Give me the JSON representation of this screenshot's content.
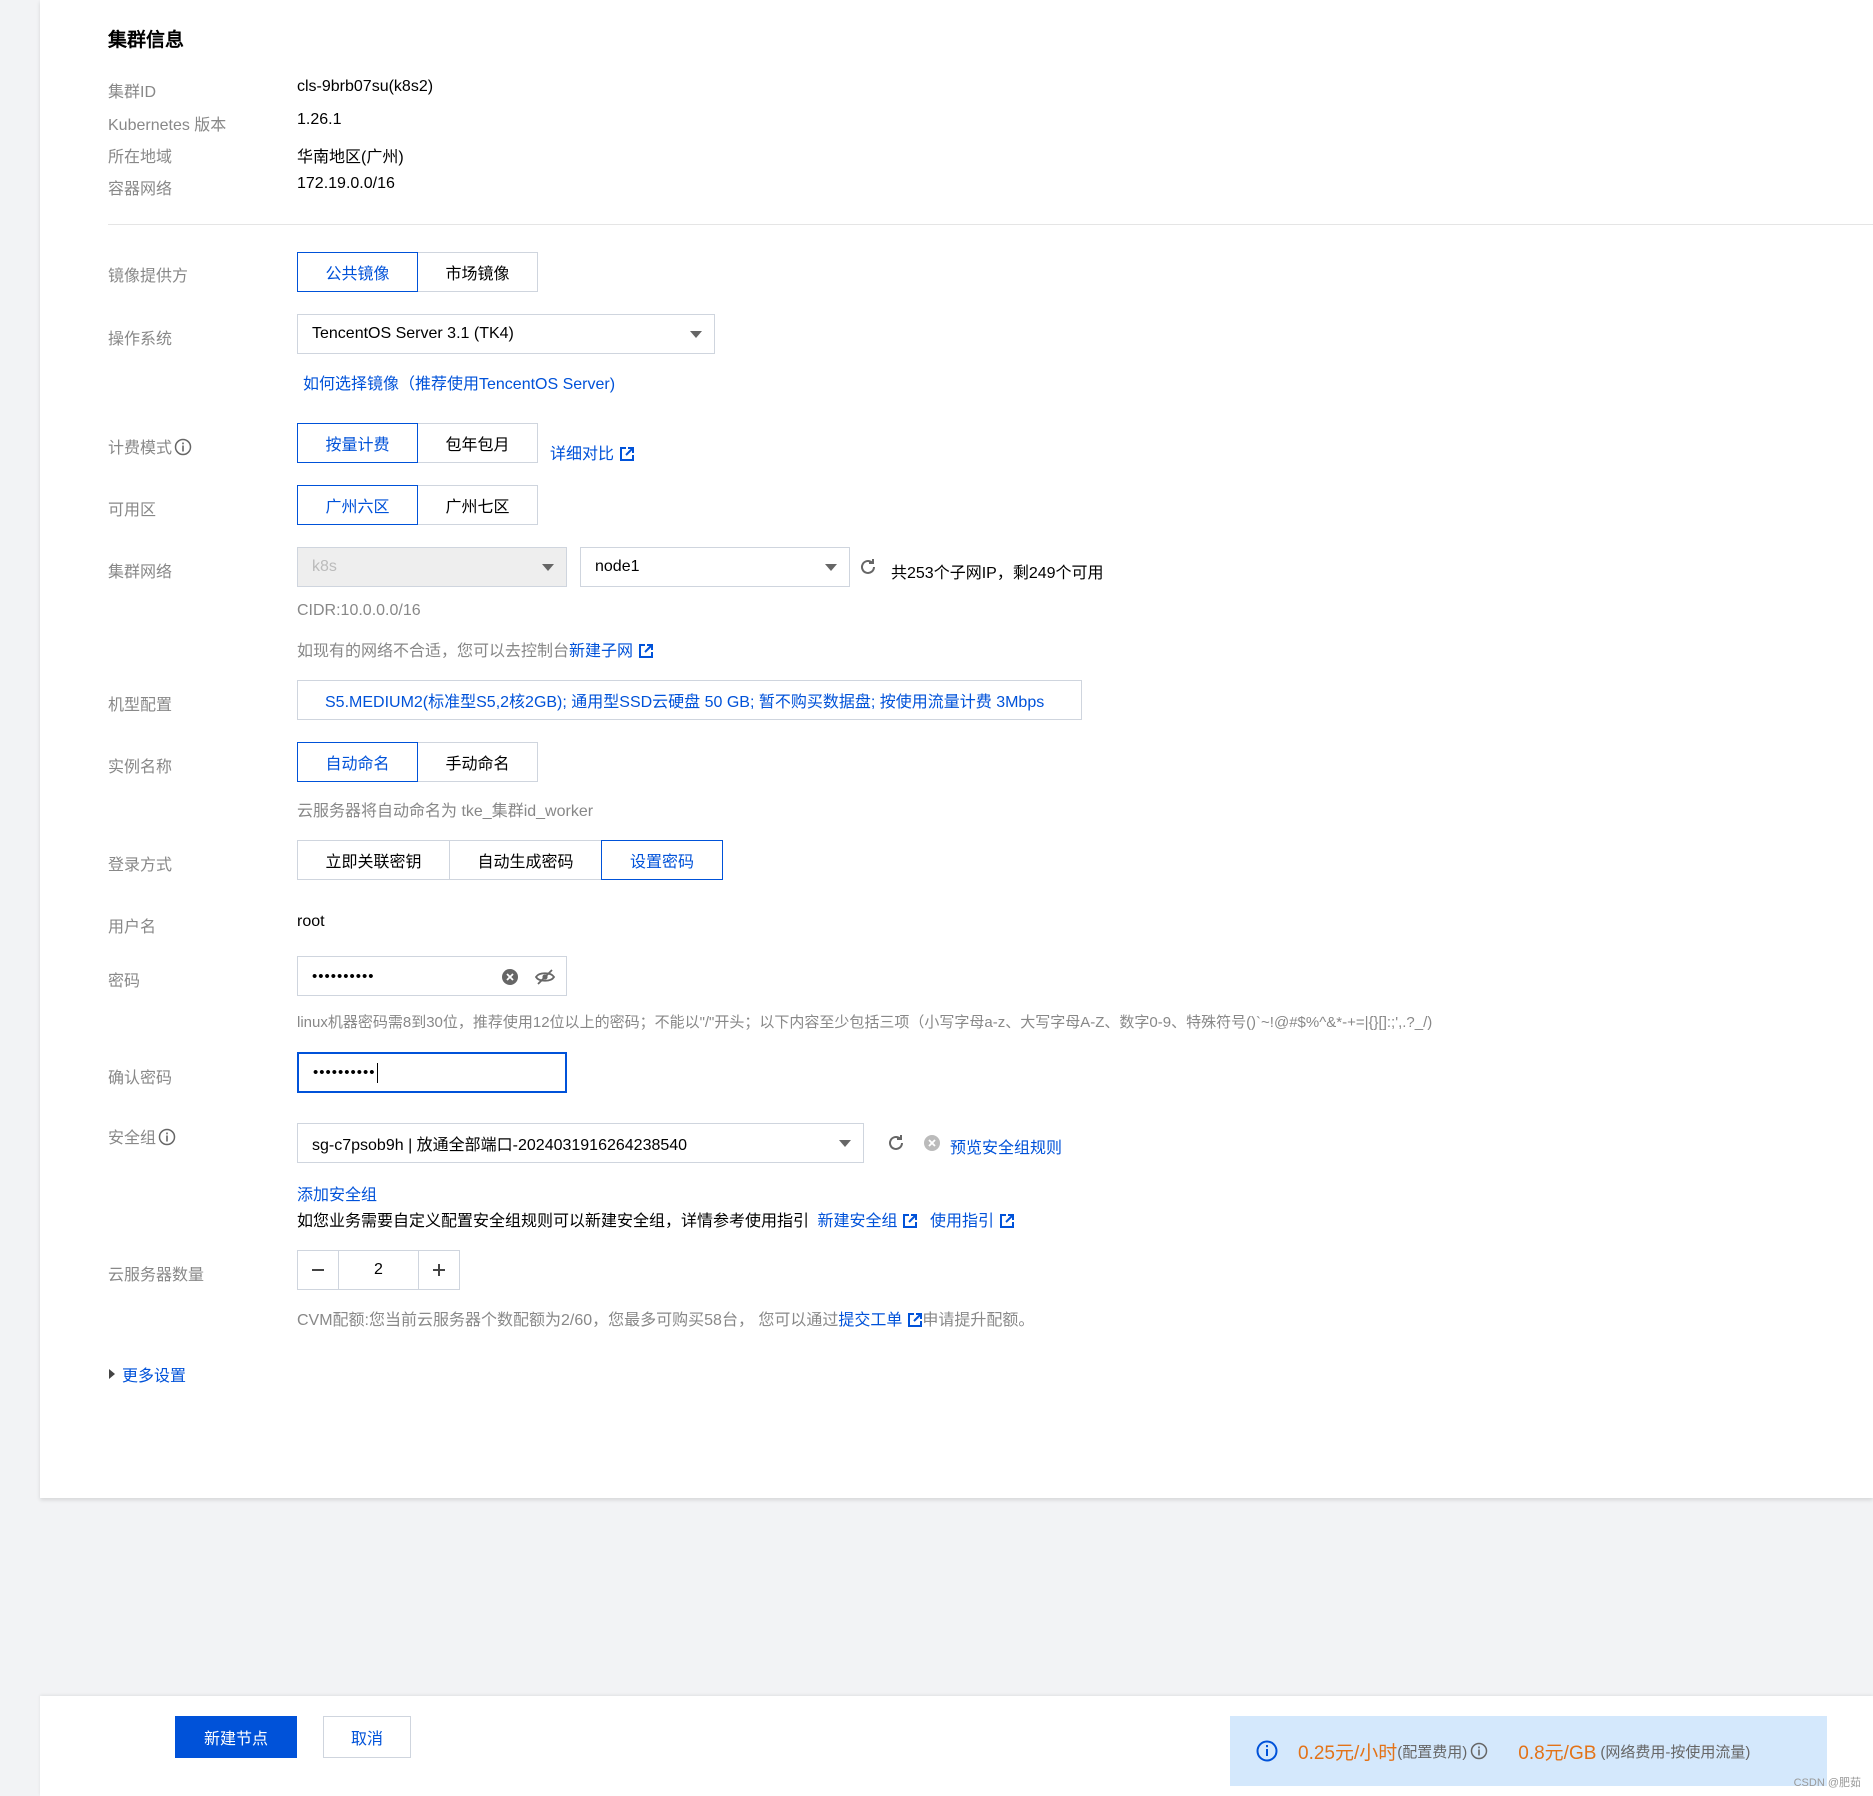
{
  "cluster_info": {
    "title": "集群信息",
    "rows": [
      {
        "label": "集群ID",
        "value": "cls-9brb07su(k8s2)"
      },
      {
        "label": "Kubernetes 版本",
        "value": "1.26.1"
      },
      {
        "label": "所在地域",
        "value": "华南地区(广州)"
      },
      {
        "label": "容器网络",
        "value": "172.19.0.0/16"
      }
    ]
  },
  "form": {
    "image_provider": {
      "label": "镜像提供方",
      "options": [
        "公共镜像",
        "市场镜像"
      ],
      "selected": "公共镜像"
    },
    "os": {
      "label": "操作系统",
      "value": "TencentOS Server 3.1 (TK4)",
      "help_link": "如何选择镜像（推荐使用TencentOS Server)"
    },
    "billing": {
      "label": "计费模式",
      "options": [
        "按量计费",
        "包年包月"
      ],
      "selected": "按量计费",
      "compare_link": "详细对比"
    },
    "zone": {
      "label": "可用区",
      "options": [
        "广州六区",
        "广州七区"
      ],
      "selected": "广州六区"
    },
    "network": {
      "label": "集群网络",
      "vpc": "k8s",
      "subnet": "node1",
      "ip_info": "共253个子网IP，剩249个可用",
      "cidr": "CIDR:10.0.0.0/16",
      "hint_prefix": "如现有的网络不合适，您可以去控制台",
      "hint_link": "新建子网"
    },
    "machine": {
      "label": "机型配置",
      "value": "S5.MEDIUM2(标准型S5,2核2GB); 通用型SSD云硬盘 50 GB; 暂不购买数据盘; 按使用流量计费 3Mbps"
    },
    "instance_name": {
      "label": "实例名称",
      "options": [
        "自动命名",
        "手动命名"
      ],
      "selected": "自动命名",
      "hint": "云服务器将自动命名为 tke_集群id_worker"
    },
    "login": {
      "label": "登录方式",
      "options": [
        "立即关联密钥",
        "自动生成密码",
        "设置密码"
      ],
      "selected": "设置密码"
    },
    "username": {
      "label": "用户名",
      "value": "root"
    },
    "password": {
      "label": "密码",
      "value": "••••••••••",
      "hint": "linux机器密码需8到30位，推荐使用12位以上的密码；不能以\"/\"开头；以下内容至少包括三项（小写字母a-z、大写字母A-Z、数字0-9、特殊符号()`~!@#$%^&*-+=|{}[]:;',.?_/)"
    },
    "confirm_password": {
      "label": "确认密码",
      "value": "••••••••••"
    },
    "security_group": {
      "label": "安全组",
      "value": "sg-c7psob9h | 放通全部端口-2024031916264238540",
      "preview_link": "预览安全组规则",
      "add_link": "添加安全组",
      "hint": "如您业务需要自定义配置安全组规则可以新建安全组，详情参考使用指引",
      "new_link": "新建安全组",
      "guide_link": "使用指引"
    },
    "count": {
      "label": "云服务器数量",
      "value": "2",
      "hint_prefix": "CVM配额:您当前云服务器个数配额为2/60，您最多可购买58台， 您可以通过",
      "hint_link": "提交工单",
      "hint_suffix": "申请提升配额。"
    },
    "more_settings": "更多设置"
  },
  "footer": {
    "create_button": "新建节点",
    "cancel_button": "取消",
    "price_config": "0.25元/小时",
    "price_config_note": "(配置费用)",
    "price_network": "0.8元/GB",
    "price_network_note": "(网络费用-按使用流量)"
  },
  "watermark": "CSDN @肥茹",
  "colors": {
    "primary": "#0052d9",
    "price": "#e37318",
    "price_bg": "#d4e8fc"
  }
}
